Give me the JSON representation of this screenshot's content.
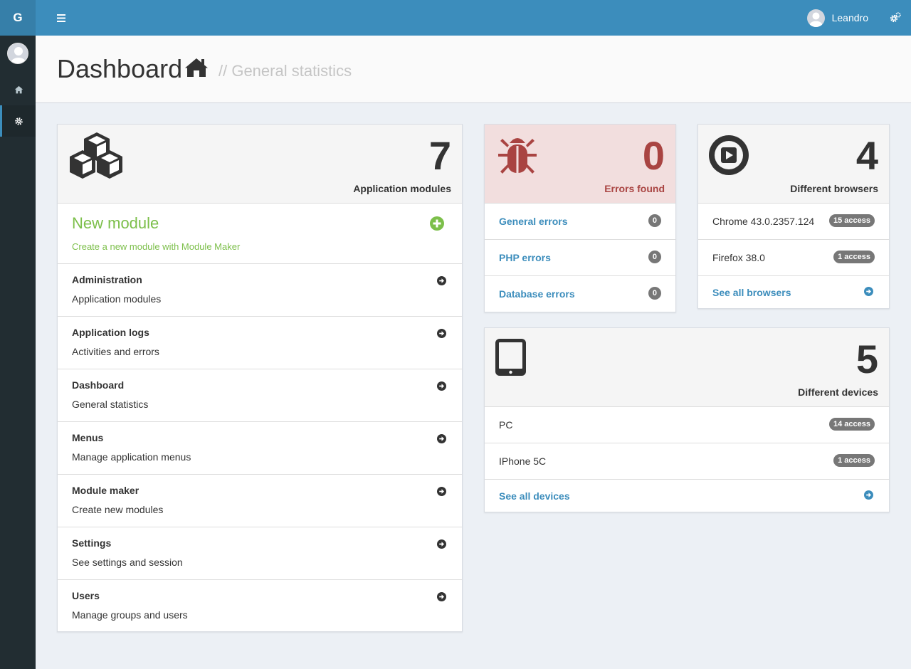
{
  "brand": "G",
  "topbar": {
    "user_name": "Leandro"
  },
  "header": {
    "title": "Dashboard",
    "subtitle": "// General statistics"
  },
  "modules_panel": {
    "count": "7",
    "label": "Application modules",
    "new_module": {
      "title": "New module",
      "desc": "Create a new module with Module Maker"
    },
    "items": [
      {
        "title": "Administration",
        "desc": "Application modules"
      },
      {
        "title": "Application logs",
        "desc": "Activities and errors"
      },
      {
        "title": "Dashboard",
        "desc": "General statistics"
      },
      {
        "title": "Menus",
        "desc": "Manage application menus"
      },
      {
        "title": "Module maker",
        "desc": "Create new modules"
      },
      {
        "title": "Settings",
        "desc": "See settings and session"
      },
      {
        "title": "Users",
        "desc": "Manage groups and users"
      }
    ]
  },
  "errors_panel": {
    "count": "0",
    "label": "Errors found",
    "items": [
      {
        "label": "General errors",
        "badge": "0"
      },
      {
        "label": "PHP errors",
        "badge": "0"
      },
      {
        "label": "Database errors",
        "badge": "0"
      }
    ]
  },
  "browsers_panel": {
    "count": "4",
    "label": "Different browsers",
    "items": [
      {
        "label": "Chrome 43.0.2357.124",
        "badge": "15 access"
      },
      {
        "label": "Firefox 38.0",
        "badge": "1 access"
      }
    ],
    "see_all": "See all browsers"
  },
  "devices_panel": {
    "count": "5",
    "label": "Different devices",
    "items": [
      {
        "label": "PC",
        "badge": "14 access"
      },
      {
        "label": "IPhone 5C",
        "badge": "1 access"
      }
    ],
    "see_all": "See all devices"
  },
  "colors": {
    "primary": "#3c8dbc",
    "success": "#7cbf4a",
    "danger": "#a94442",
    "sidebar": "#222d32"
  }
}
